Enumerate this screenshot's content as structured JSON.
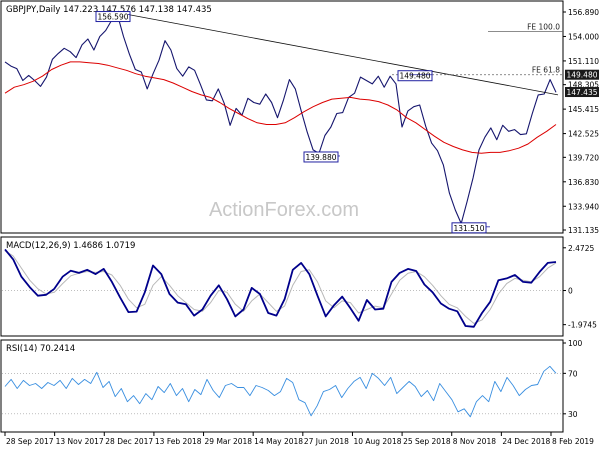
{
  "chart_data": {
    "type": "line",
    "panels": [
      {
        "id": "price",
        "title": "GBPJPY,Daily  147.223 147.576 147.138 147.435",
        "y_ticks": [
          131.135,
          133.94,
          136.83,
          139.72,
          142.525,
          145.415,
          148.305,
          151.11,
          154.0,
          156.89
        ],
        "y_range": [
          131.135,
          156.89
        ],
        "last_price": "147.435",
        "annotations": [
          {
            "label": "156.590",
            "value": 156.59
          },
          {
            "label": "139.880",
            "value": 139.88
          },
          {
            "label": "131.510",
            "value": 131.51
          },
          {
            "label": "149.480",
            "value": 149.48
          }
        ],
        "fib_levels": [
          {
            "label": "FE 100.0",
            "value": 154.6
          },
          {
            "label": "FE 61.8",
            "value": 149.48
          }
        ],
        "axis_tags": [
          "149.480",
          "147.435"
        ],
        "series": [
          {
            "name": "price",
            "color": "#16166e",
            "values": [
              151.0,
              150.5,
              150.2,
              148.8,
              149.4,
              148.8,
              148.1,
              149.2,
              151.3,
              152.0,
              152.6,
              152.2,
              151.5,
              153.0,
              153.7,
              152.4,
              154.0,
              154.7,
              155.9,
              156.5,
              154.0,
              151.9,
              150.1,
              149.8,
              147.8,
              149.6,
              151.2,
              153.5,
              152.4,
              150.2,
              149.3,
              150.4,
              150.0,
              148.3,
              146.5,
              146.4,
              147.8,
              146.1,
              143.5,
              145.5,
              144.7,
              146.7,
              146.2,
              146.0,
              147.2,
              146.2,
              144.4,
              146.5,
              148.9,
              147.8,
              145.2,
              142.7,
              140.6,
              140.2,
              142.3,
              143.3,
              144.9,
              145.0,
              146.8,
              147.3,
              149.2,
              148.8,
              148.4,
              149.3,
              148.0,
              149.3,
              148.4,
              143.3,
              145.2,
              145.7,
              145.9,
              143.4,
              141.4,
              140.5,
              138.8,
              135.5,
              133.5,
              131.9,
              134.5,
              137.3,
              140.6,
              142.1,
              143.2,
              141.8,
              143.5,
              142.8,
              143.0,
              142.4,
              142.5,
              144.9,
              147.1,
              147.2,
              148.9,
              147.4
            ]
          },
          {
            "name": "SMA",
            "color": "#dc0000",
            "values": [
              147.3,
              148.0,
              148.3,
              148.7,
              149.3,
              150.1,
              150.6,
              151.0,
              151.0,
              150.9,
              150.8,
              150.6,
              150.3,
              150.0,
              149.6,
              149.3,
              149.1,
              148.9,
              148.5,
              148.0,
              147.5,
              147.1,
              146.8,
              146.2,
              145.5,
              144.9,
              144.3,
              143.8,
              143.6,
              143.6,
              143.8,
              144.4,
              145.1,
              145.7,
              146.2,
              146.6,
              146.7,
              146.8,
              146.6,
              146.5,
              146.3,
              145.9,
              145.3,
              144.4,
              143.8,
              143.0,
              142.2,
              141.5,
              141.0,
              140.6,
              140.3,
              140.2,
              140.3,
              140.3,
              140.5,
              140.8,
              141.3,
              142.1,
              142.8,
              143.6
            ]
          },
          {
            "name": "trendline",
            "color": "#111111",
            "values": [
              156.59,
              147.1
            ]
          }
        ]
      },
      {
        "id": "macd",
        "title": "MACD(12,26,9)  1.4686  1.0719",
        "y_ticks": [
          -1.9745,
          0.0,
          2.4725
        ],
        "y_range": [
          -2.4,
          2.75
        ],
        "series": [
          {
            "name": "MACD",
            "color": "#00008b",
            "values": [
              2.38,
              1.8,
              0.8,
              0.2,
              -0.3,
              -0.25,
              0.1,
              0.8,
              1.15,
              1.02,
              1.2,
              0.95,
              1.25,
              0.5,
              -0.4,
              -1.25,
              -1.22,
              -0.1,
              1.45,
              0.95,
              -0.2,
              -0.7,
              -0.8,
              -1.45,
              -1.1,
              -0.3,
              0.3,
              -0.5,
              -1.5,
              -1.1,
              0.15,
              -0.2,
              -1.3,
              -1.45,
              -0.5,
              1.2,
              1.6,
              0.95,
              -0.3,
              -1.5,
              -0.85,
              -0.35,
              -1.02,
              -1.75,
              -0.55,
              -1.1,
              -1.05,
              0.5,
              1.02,
              1.25,
              1.13,
              0.35,
              -0.1,
              -0.75,
              -1.05,
              -1.2,
              -2.05,
              -2.1,
              -1.3,
              -0.65,
              0.6,
              0.7,
              0.9,
              0.5,
              0.45,
              1.08,
              1.6,
              1.65
            ]
          },
          {
            "name": "Signal",
            "color": "#b8b8b8",
            "values": [
              2.3,
              2.0,
              1.3,
              0.6,
              0.1,
              -0.2,
              -0.1,
              0.4,
              0.85,
              1.0,
              1.1,
              1.05,
              1.1,
              0.9,
              0.3,
              -0.5,
              -1.0,
              -0.8,
              0.3,
              0.8,
              0.3,
              -0.3,
              -0.7,
              -1.1,
              -1.2,
              -0.7,
              0.0,
              -0.1,
              -0.8,
              -1.2,
              -0.6,
              -0.2,
              -0.7,
              -1.2,
              -0.9,
              0.3,
              1.1,
              1.2,
              0.5,
              -0.6,
              -1.0,
              -0.6,
              -0.7,
              -1.3,
              -1.1,
              -0.9,
              -1.0,
              -0.2,
              0.6,
              1.0,
              1.1,
              0.8,
              0.3,
              -0.3,
              -0.8,
              -1.0,
              -1.5,
              -1.9,
              -1.7,
              -1.1,
              -0.2,
              0.4,
              0.7,
              0.6,
              0.5,
              0.8,
              1.3,
              1.6
            ]
          }
        ]
      },
      {
        "id": "rsi",
        "title": "RSI(14)  70.2414",
        "y_ticks": [
          30,
          70,
          100
        ],
        "y_range": [
          14,
          100
        ],
        "series": [
          {
            "name": "RSI",
            "color": "#3a8fe0",
            "values": [
              57,
              64,
              55,
              63,
              58,
              60,
              55,
              61,
              58,
              63,
              55,
              65,
              59,
              64,
              60,
              71,
              56,
              62,
              47,
              55,
              42,
              48,
              40,
              50,
              44,
              57,
              51,
              60,
              48,
              55,
              42,
              54,
              49,
              64,
              53,
              46,
              58,
              60,
              56,
              56,
              48,
              58,
              56,
              53,
              48,
              52,
              65,
              61,
              44,
              41,
              28,
              38,
              52,
              54,
              58,
              46,
              55,
              62,
              66,
              55,
              70,
              65,
              58,
              66,
              50,
              56,
              62,
              57,
              47,
              53,
              43,
              60,
              52,
              44,
              32,
              35,
              27,
              42,
              48,
              42,
              62,
              52,
              66,
              58,
              48,
              54,
              58,
              59,
              72,
              77,
              70
            ]
          }
        ]
      }
    ],
    "x_tick_labels": [
      "28 Sep 2017",
      "13 Nov 2017",
      "28 Dec 2017",
      "13 Feb 2018",
      "29 Mar 2018",
      "14 May 2018",
      "27 Jun 2018",
      "10 Aug 2018",
      "25 Sep 2018",
      "8 Nov 2018",
      "24 Dec 2018",
      "8 Feb 2019"
    ],
    "watermark": "ActionForex.com",
    "grid": false
  },
  "colors": {
    "price": "#16166e",
    "ma": "#dc0000",
    "macd": "#00008b",
    "signal": "#b8b8b8",
    "rsi": "#3a8fe0",
    "annotation_box": "#2020a0",
    "axis": "#000000",
    "tag_bg": "#1a1a1a"
  }
}
